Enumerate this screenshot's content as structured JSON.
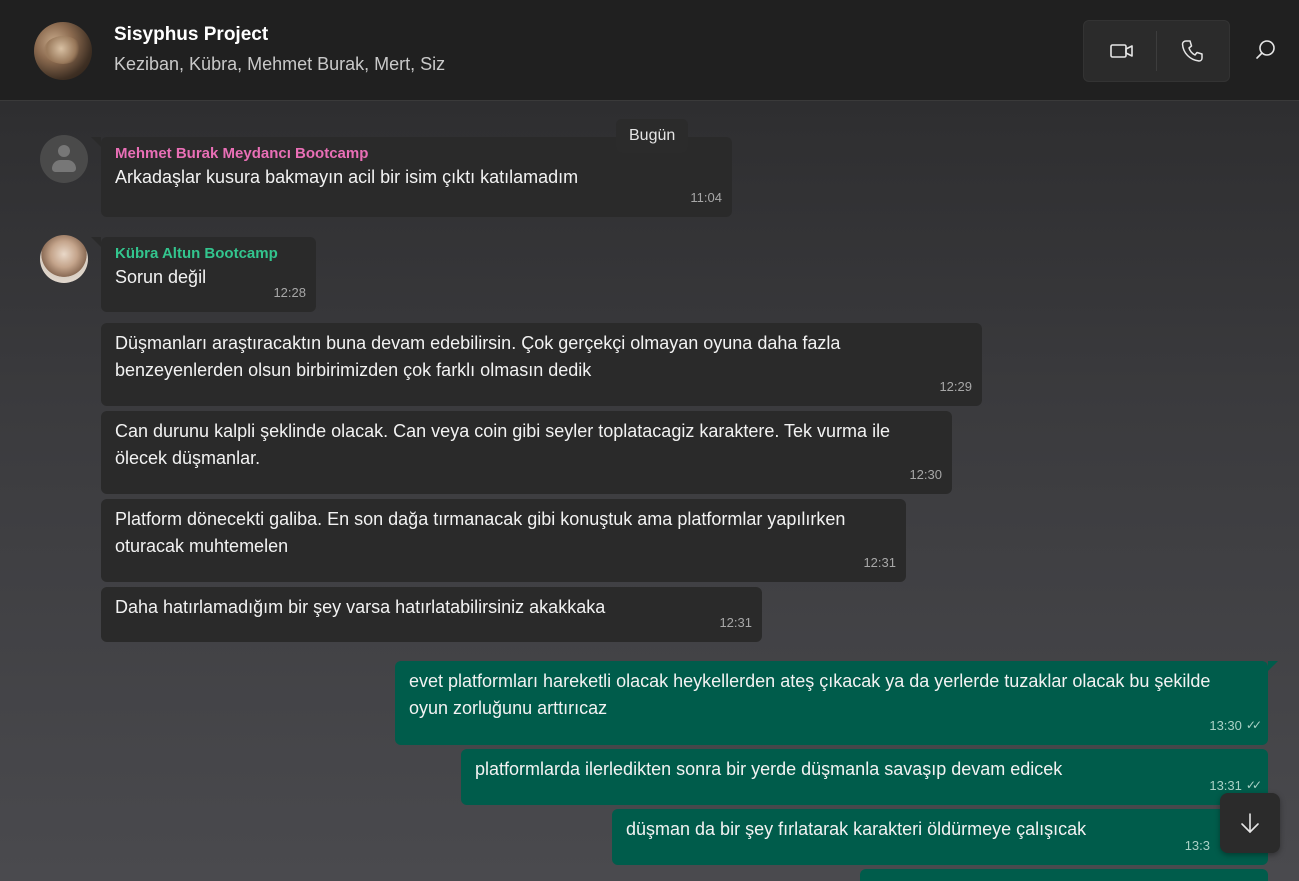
{
  "header": {
    "title": "Sisyphus Project",
    "participants": "Keziban, Kübra, Mehmet Burak, Mert, Siz",
    "icons": {
      "video": "video-camera-icon",
      "phone": "phone-icon",
      "search": "search-icon"
    }
  },
  "date_separator": "Bugün",
  "messages": [
    {
      "sender": "Mehmet Burak Meydancı Bootcamp",
      "text": "Arkadaşlar kusura bakmayın acil bir isim çıktı katılamadım",
      "time": "11:04"
    },
    {
      "sender": "Kübra Altun Bootcamp",
      "text": "Sorun değil",
      "time": "12:28"
    },
    {
      "text": "Düşmanları araştıracaktın buna devam edebilirsin. Çok gerçekçi olmayan oyuna daha fazla benzeyenlerden olsun birbirimizden çok farklı olmasın dedik",
      "time": "12:29"
    },
    {
      "text": "Can durunu kalpli şeklinde olacak. Can veya coin gibi seyler toplatacagiz karaktere. Tek vurma ile ölecek düşmanlar.",
      "time": "12:30"
    },
    {
      "text": "Platform dönecekti galiba. En son dağa tırmanacak gibi konuştuk ama platformlar yapılırken oturacak muhtemelen",
      "time": "12:31"
    },
    {
      "text": "Daha hatırlamadığım bir şey varsa hatırlatabilirsiniz akakkaka",
      "time": "12:31"
    },
    {
      "text": "evet platformları hareketli olacak heykellerden ateş çıkacak ya da yerlerde tuzaklar olacak bu şekilde oyun zorluğunu arttırıcaz",
      "time": "13:30"
    },
    {
      "text": "platformlarda ilerledikten sonra bir yerde düşmanla savaşıp devam edicek",
      "time": "13:31"
    },
    {
      "text": "düşman da bir şey fırlatarak karakteri öldürmeye çalışıcak",
      "time": "13:3"
    }
  ],
  "colors": {
    "outgoing": "#005c4b",
    "incoming": "#2a2a2a",
    "sender_pink": "#e96fb6",
    "sender_green": "#33c58e"
  }
}
